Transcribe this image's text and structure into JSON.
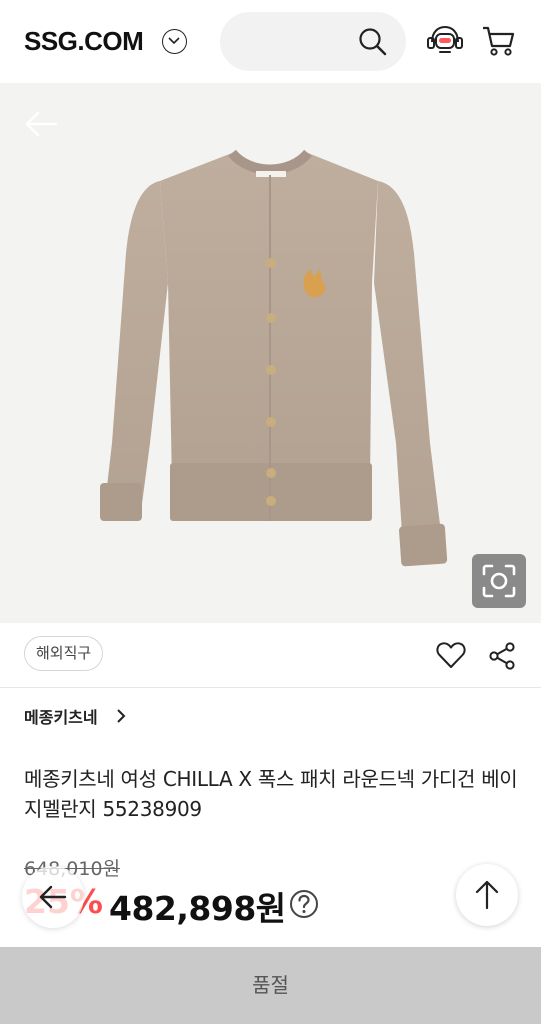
{
  "header": {
    "logo": "SSG.COM",
    "search_placeholder": ""
  },
  "icons": {
    "search": "search-icon",
    "bot": "chatbot-icon",
    "cart": "cart-icon",
    "heart": "heart-icon",
    "share": "share-icon",
    "lens": "image-search-icon"
  },
  "product": {
    "tag": "해외직구",
    "brand": "메종키츠네",
    "title": "메종키츠네 여성 CHILLA X 폭스 패치 라운드넥 가디건 베이지멜란지 55238909",
    "original_price": "648,010원",
    "discount": "25%",
    "price": "482,898원"
  },
  "bottom": {
    "button_label": "품절"
  },
  "colors": {
    "discount": "#ff4d4d",
    "soldout_bg": "#c9c9c9",
    "image_bg": "#f3f3f1",
    "cardigan": "#b9a898"
  }
}
